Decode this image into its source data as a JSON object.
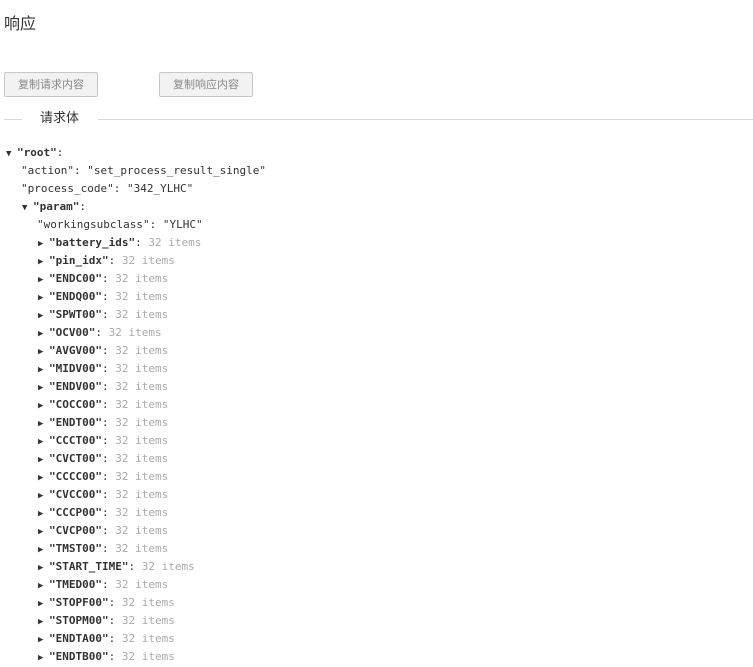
{
  "page_title": "响应",
  "buttons": {
    "copy_request": "复制请求内容",
    "copy_response": "复制响应内容"
  },
  "section_label": "请求体",
  "icons": {
    "expanded": "▼",
    "collapsed": "▶"
  },
  "tree": {
    "root": {
      "key": "\"root\"",
      "colon": ":"
    },
    "action": {
      "key": "\"action\"",
      "sep": ": ",
      "value": "\"set_process_result_single\""
    },
    "process_code": {
      "key": "\"process_code\"",
      "sep": ": ",
      "value": "\"342_YLHC\""
    },
    "param": {
      "key": "\"param\"",
      "colon": ":"
    },
    "workingsubclass": {
      "key": "\"workingsubclass\"",
      "sep": ": ",
      "value": "\"YLHC\""
    },
    "param_items": [
      {
        "key": "\"battery_ids\"",
        "count": "32 items"
      },
      {
        "key": "\"pin_idx\"",
        "count": "32 items"
      },
      {
        "key": "\"ENDC00\"",
        "count": "32 items"
      },
      {
        "key": "\"ENDQ00\"",
        "count": "32 items"
      },
      {
        "key": "\"SPWT00\"",
        "count": "32 items"
      },
      {
        "key": "\"OCV00\"",
        "count": "32 items"
      },
      {
        "key": "\"AVGV00\"",
        "count": "32 items"
      },
      {
        "key": "\"MIDV00\"",
        "count": "32 items"
      },
      {
        "key": "\"ENDV00\"",
        "count": "32 items"
      },
      {
        "key": "\"COCC00\"",
        "count": "32 items"
      },
      {
        "key": "\"ENDT00\"",
        "count": "32 items"
      },
      {
        "key": "\"CCCT00\"",
        "count": "32 items"
      },
      {
        "key": "\"CVCT00\"",
        "count": "32 items"
      },
      {
        "key": "\"CCCC00\"",
        "count": "32 items"
      },
      {
        "key": "\"CVCC00\"",
        "count": "32 items"
      },
      {
        "key": "\"CCCP00\"",
        "count": "32 items"
      },
      {
        "key": "\"CVCP00\"",
        "count": "32 items"
      },
      {
        "key": "\"TMST00\"",
        "count": "32 items"
      },
      {
        "key": "\"START_TIME\"",
        "count": "32 items"
      },
      {
        "key": "\"TMED00\"",
        "count": "32 items"
      },
      {
        "key": "\"STOPF00\"",
        "count": "32 items"
      },
      {
        "key": "\"STOPM00\"",
        "count": "32 items"
      },
      {
        "key": "\"ENDTA00\"",
        "count": "32 items"
      },
      {
        "key": "\"ENDTB00\"",
        "count": "32 items"
      }
    ]
  }
}
